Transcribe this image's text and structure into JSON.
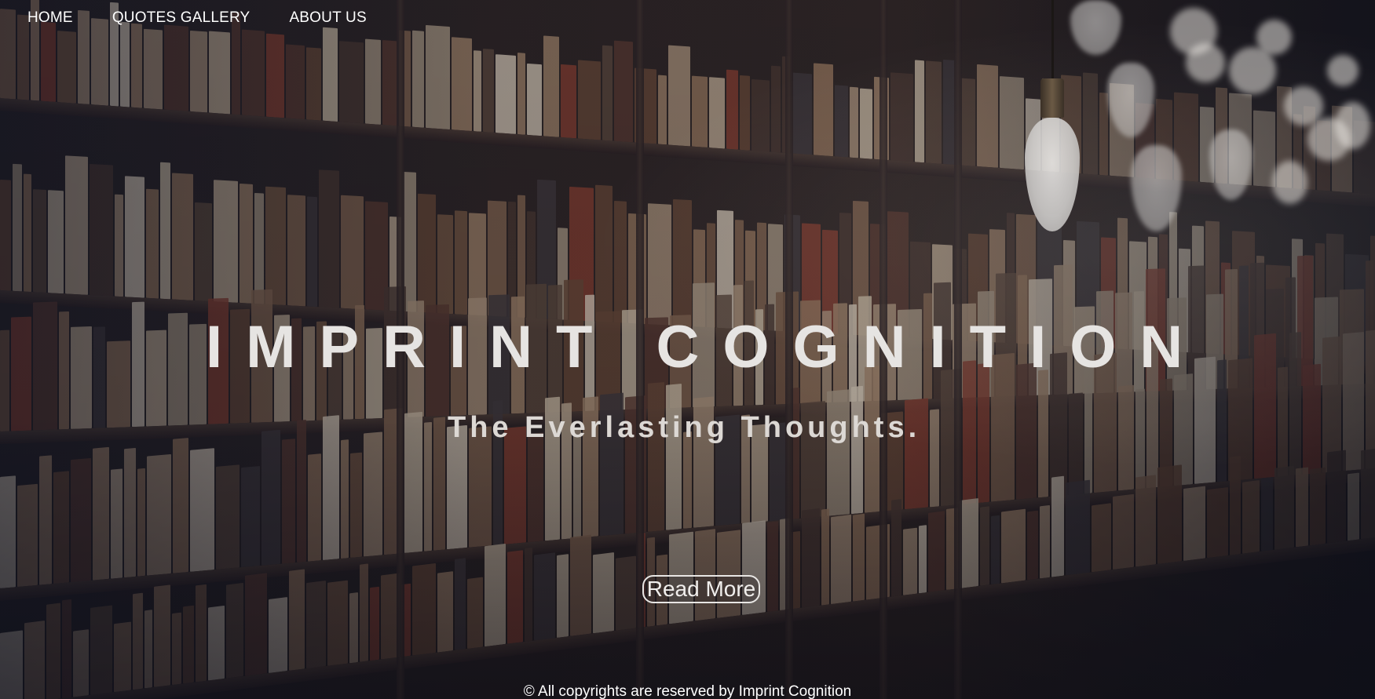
{
  "nav": {
    "items": [
      {
        "label": "HOME"
      },
      {
        "label": "QUOTES GALLERY"
      },
      {
        "label": "ABOUT US"
      }
    ]
  },
  "hero": {
    "title": "IMPRINT COGNITION",
    "subtitle": "The Everlasting Thoughts.",
    "cta_label": "Read More"
  },
  "footer": {
    "text": "© All copyrights are reserved by Imprint Cognition"
  },
  "colors": {
    "nav_text": "#ffffff",
    "title": "#e6e4e2",
    "background_dark": "#1a1518"
  },
  "background": {
    "image_subject": "library bookshelves with hanging light bulbs"
  }
}
